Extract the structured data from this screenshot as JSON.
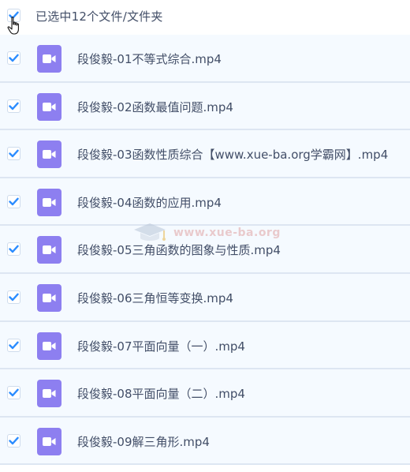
{
  "header": {
    "selected_text": "已选中12个文件/文件夹"
  },
  "files": [
    {
      "name": "段俊毅-01不等式综合.mp4"
    },
    {
      "name": "段俊毅-02函数最值问题.mp4"
    },
    {
      "name": "段俊毅-03函数性质综合【www.xue-ba.org学霸网】.mp4"
    },
    {
      "name": "段俊毅-04函数的应用.mp4"
    },
    {
      "name": "段俊毅-05三角函数的图象与性质.mp4"
    },
    {
      "name": "段俊毅-06三角恒等变换.mp4"
    },
    {
      "name": "段俊毅-07平面向量（一）.mp4"
    },
    {
      "name": "段俊毅-08平面向量（二）.mp4"
    },
    {
      "name": "段俊毅-09解三角形.mp4"
    }
  ],
  "watermark": {
    "text": "www.xue-ba.org"
  },
  "colors": {
    "checkmark": "#2b8cff",
    "video_icon_bg": "#8d7ff0",
    "row_selected_bg": "#f5faff",
    "text": "#424e67"
  },
  "icons": {
    "select_all": "checkbox-checked-icon",
    "file": "video-file-icon",
    "cursor": "hand-pointer-icon",
    "watermark": "graduation-cap-icon"
  }
}
